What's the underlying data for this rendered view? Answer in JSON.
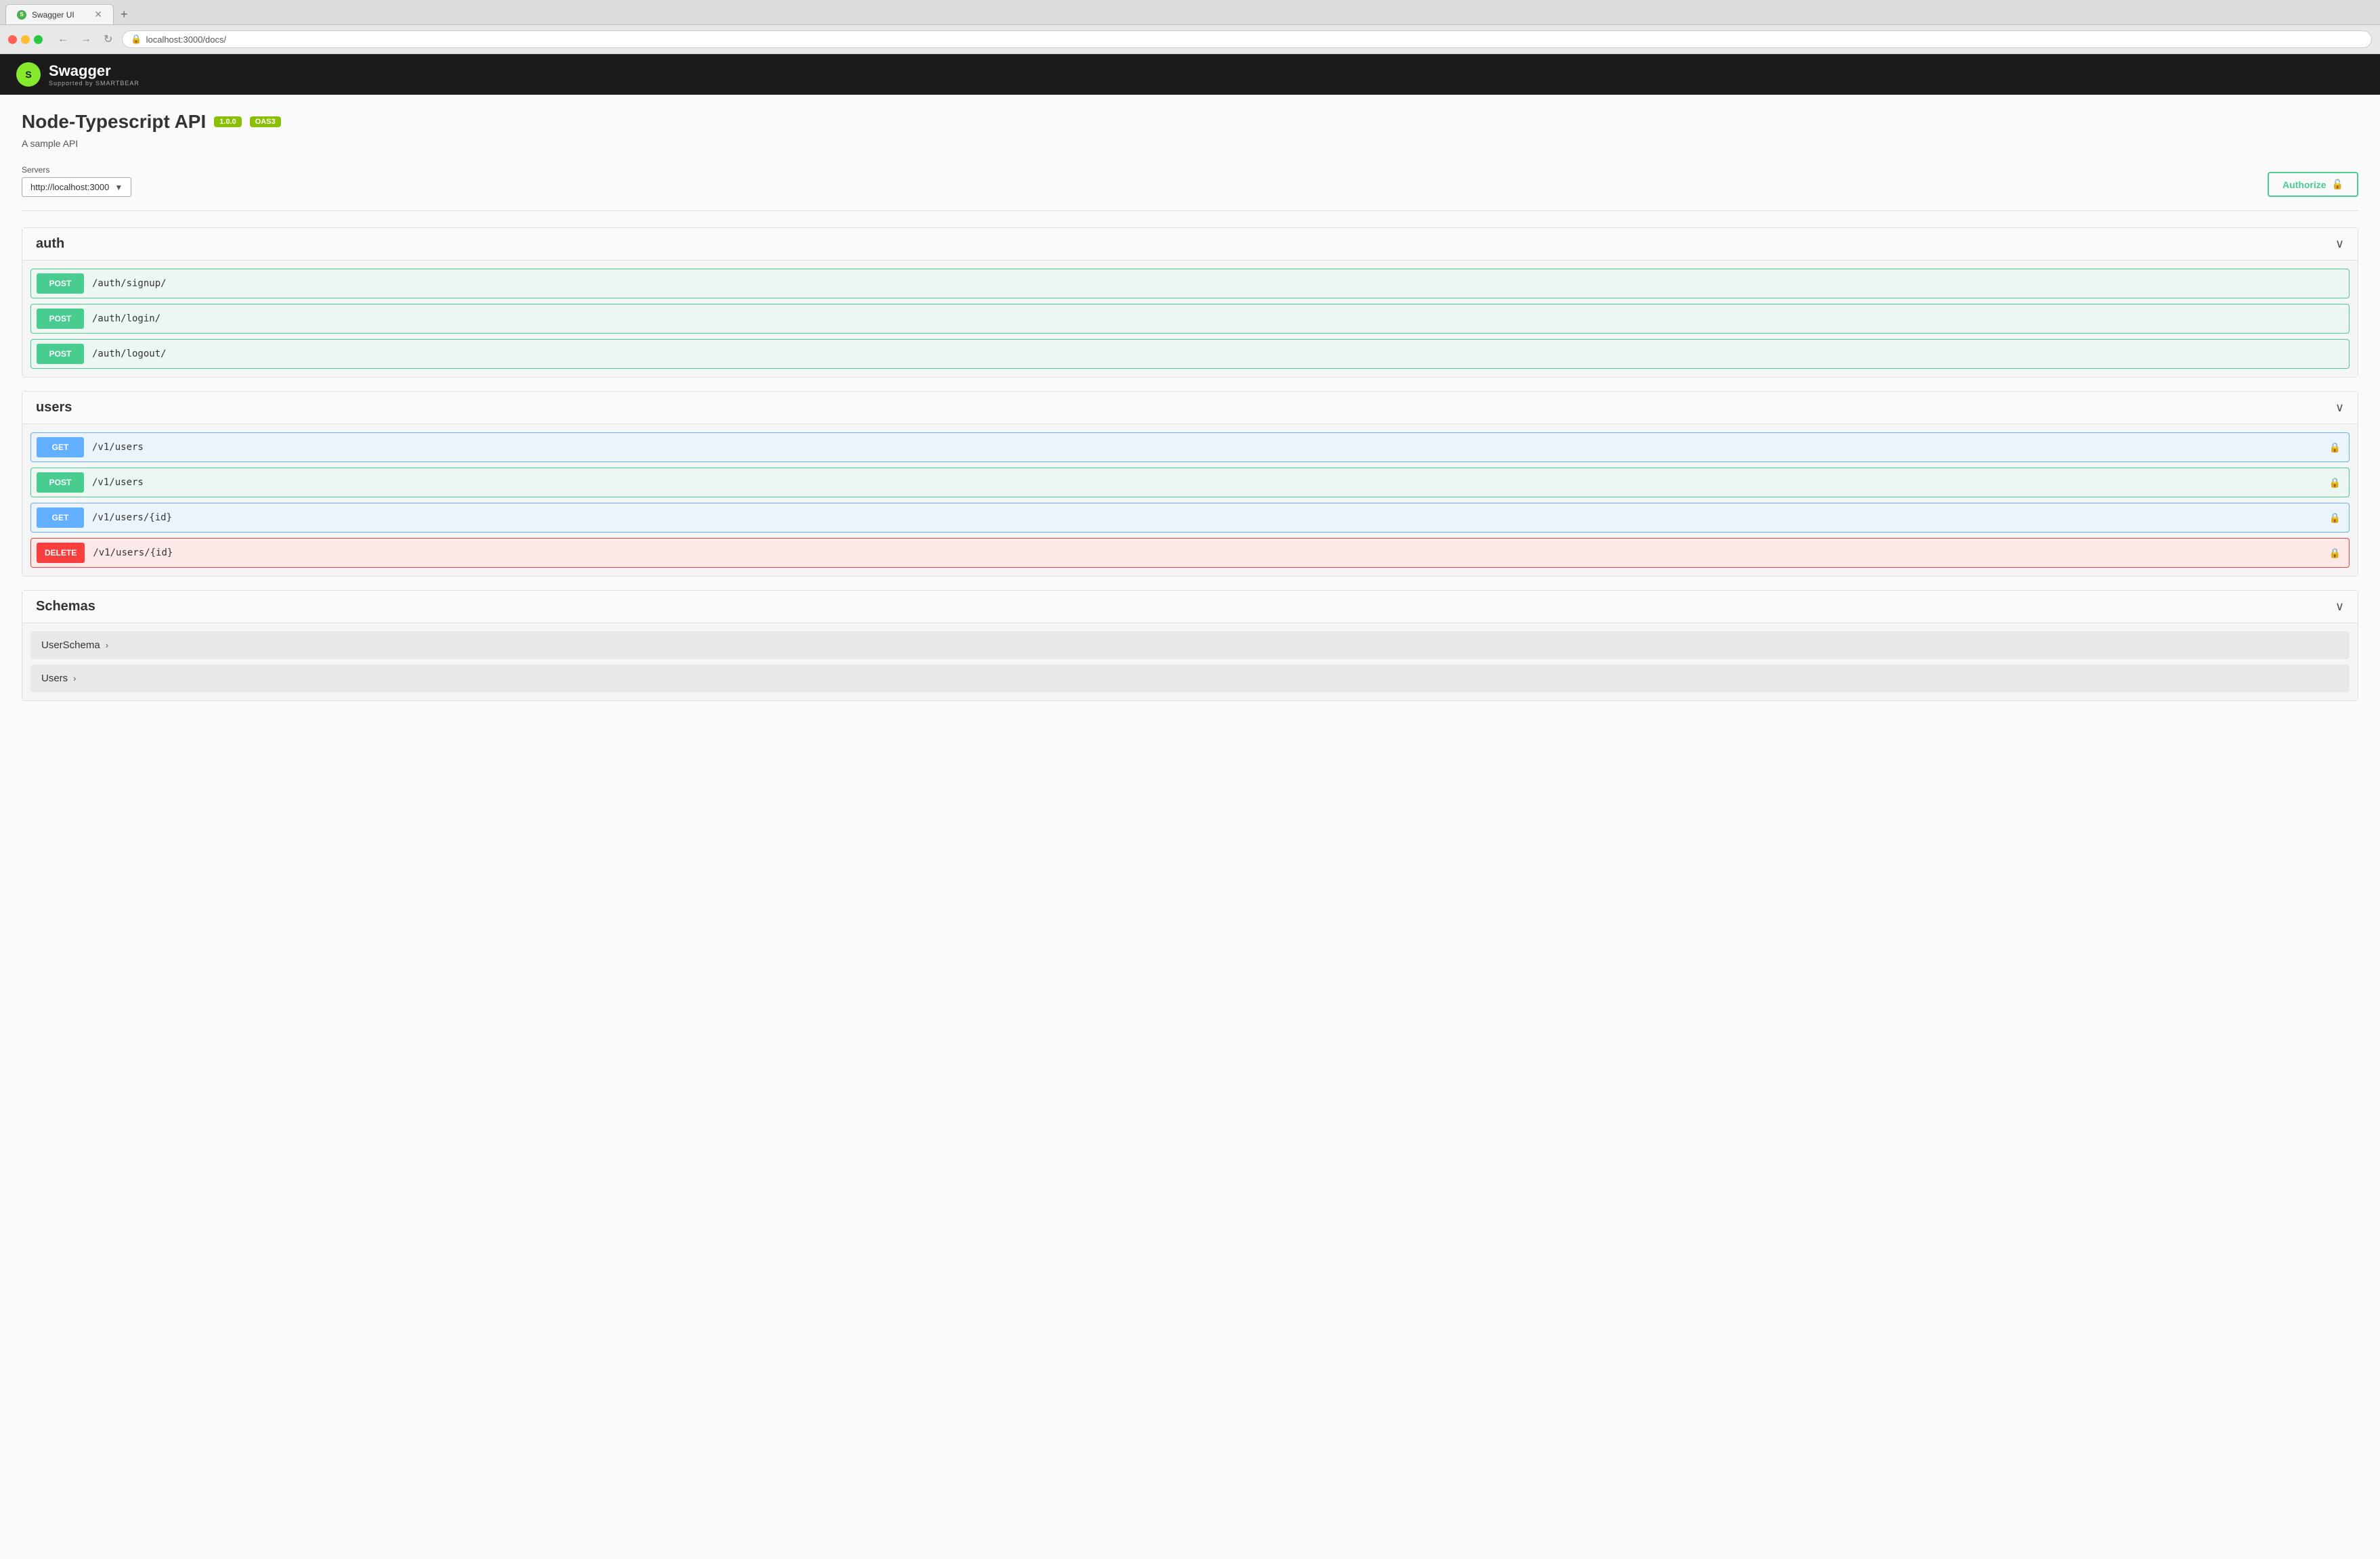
{
  "browser": {
    "tab_title": "Swagger UI",
    "tab_favicon": "S",
    "url": "localhost:3000/docs/",
    "new_tab_label": "+"
  },
  "nav": {
    "back": "←",
    "forward": "→",
    "reload": "↻"
  },
  "swagger": {
    "logo_text": "S",
    "brand": "Swagger",
    "sub": "Supported by SMARTBEAR"
  },
  "api": {
    "title": "Node-Typescript API",
    "version_badge": "1.0.0",
    "oas_badge": "OAS3",
    "description": "A sample API"
  },
  "servers": {
    "label": "Servers",
    "selected": "http://localhost:3000",
    "options": [
      "http://localhost:3000"
    ]
  },
  "authorize": {
    "label": "Authorize",
    "icon": "🔓"
  },
  "groups": [
    {
      "name": "auth",
      "id": "auth",
      "endpoints": [
        {
          "method": "POST",
          "path": "/auth/signup/",
          "locked": false
        },
        {
          "method": "POST",
          "path": "/auth/login/",
          "locked": false
        },
        {
          "method": "POST",
          "path": "/auth/logout/",
          "locked": false
        }
      ]
    },
    {
      "name": "users",
      "id": "users",
      "endpoints": [
        {
          "method": "GET",
          "path": "/v1/users",
          "locked": true
        },
        {
          "method": "POST",
          "path": "/v1/users",
          "locked": true
        },
        {
          "method": "GET",
          "path": "/v1/users/{id}",
          "locked": true
        },
        {
          "method": "DELETE",
          "path": "/v1/users/{id}",
          "locked": true
        }
      ]
    }
  ],
  "schemas": {
    "title": "Schemas",
    "items": [
      {
        "name": "UserSchema",
        "expand": "›"
      },
      {
        "name": "Users",
        "expand": "›"
      }
    ]
  },
  "colors": {
    "get": "#61affe",
    "post": "#49cc90",
    "delete": "#f93e3e",
    "authorize": "#49cc90"
  }
}
